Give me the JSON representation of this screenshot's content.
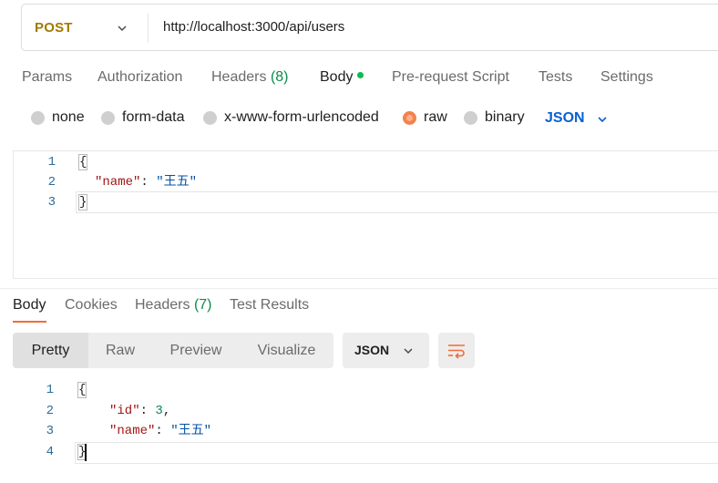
{
  "request": {
    "method": "POST",
    "url": "http://localhost:3000/api/users"
  },
  "request_tabs": [
    {
      "label": "Params"
    },
    {
      "label": "Authorization"
    },
    {
      "label": "Headers",
      "count": "(8)"
    },
    {
      "label": "Body",
      "active": true
    },
    {
      "label": "Pre-request Script"
    },
    {
      "label": "Tests"
    },
    {
      "label": "Settings"
    }
  ],
  "body_types": [
    {
      "label": "none"
    },
    {
      "label": "form-data"
    },
    {
      "label": "x-www-form-urlencoded"
    },
    {
      "label": "raw",
      "selected": true
    },
    {
      "label": "binary"
    }
  ],
  "raw_format": "JSON",
  "request_body": {
    "line_numbers": [
      "1",
      "2",
      "3"
    ],
    "open_brace": "{",
    "key": "\"name\"",
    "colon": ": ",
    "value": "\"王五\"",
    "close_brace": "}"
  },
  "response_tabs": [
    {
      "label": "Body",
      "active": true
    },
    {
      "label": "Cookies"
    },
    {
      "label": "Headers",
      "count": "(7)"
    },
    {
      "label": "Test Results"
    }
  ],
  "response_views": [
    "Pretty",
    "Raw",
    "Preview",
    "Visualize"
  ],
  "response_format": "JSON",
  "response_body": {
    "line_numbers": [
      "1",
      "2",
      "3",
      "4"
    ],
    "open_brace": "{",
    "id_key": "\"id\"",
    "id_value": "3",
    "name_key": "\"name\"",
    "name_value": "\"王五\"",
    "comma": ",",
    "colon": ": ",
    "close_brace": "}"
  },
  "colors": {
    "method": "#a37a00",
    "accent": "#f26b3a",
    "link": "#0a61d1",
    "count": "#0c8a4c",
    "body_dot": "#0cbb52"
  },
  "icons": [
    "chevron-down-icon",
    "wrap-lines-icon"
  ]
}
